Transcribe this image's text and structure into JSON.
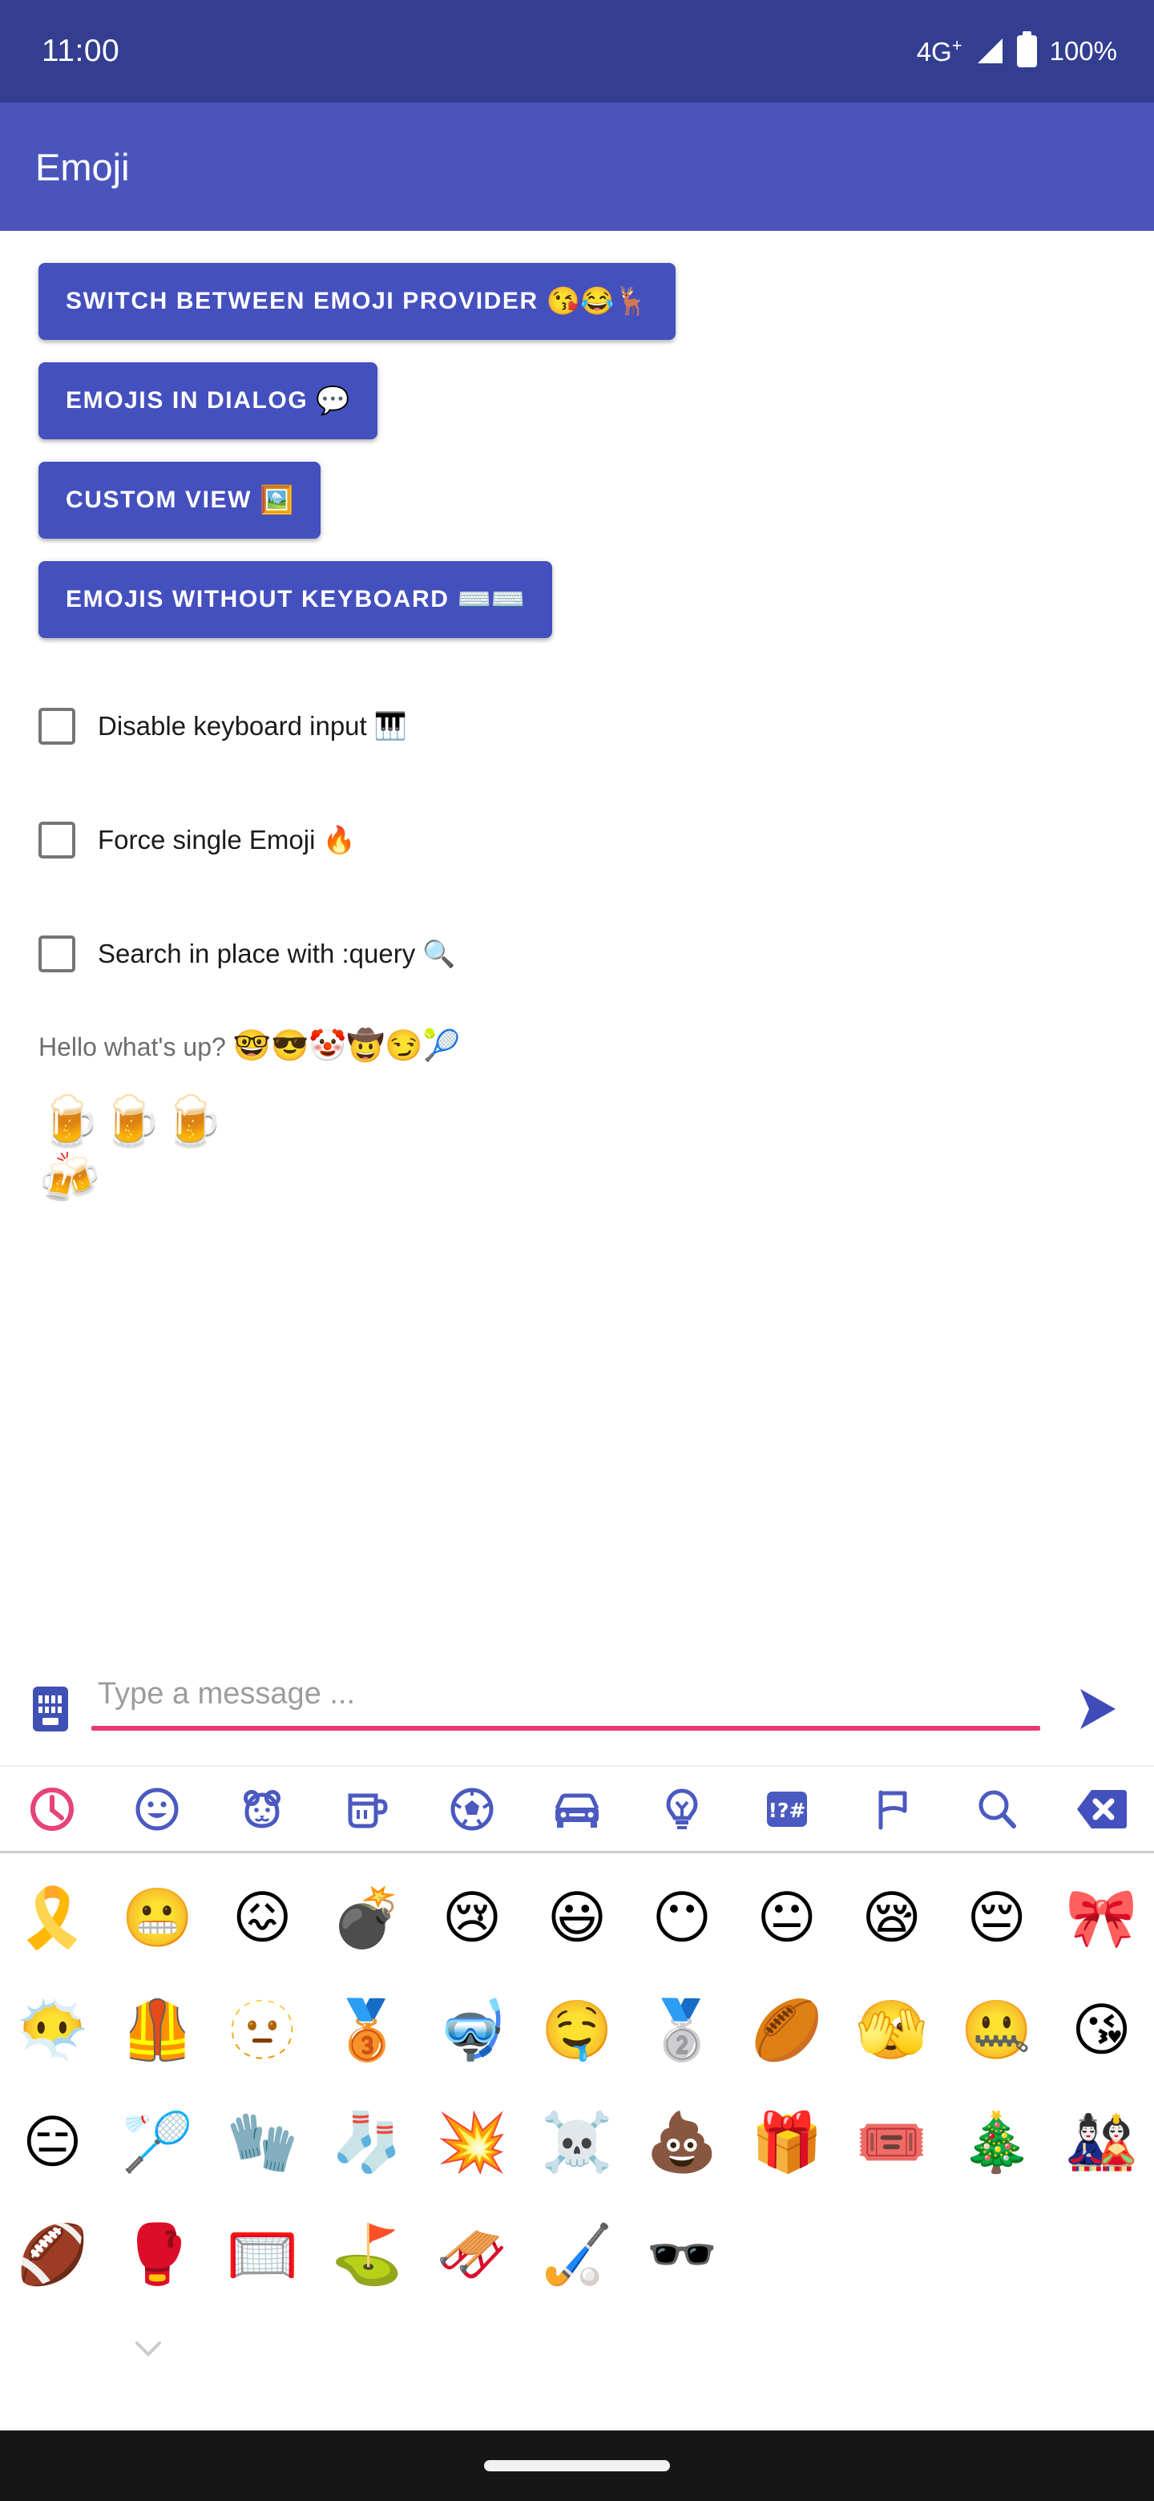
{
  "status_bar": {
    "time": "11:00",
    "network": "4G",
    "network_sup": "+",
    "battery": "100%",
    "signal_icon": "signal-bars-icon",
    "battery_icon": "battery-full-icon",
    "background": "#333E91"
  },
  "app_bar": {
    "title": "Emoji",
    "background": "#4A55BC"
  },
  "buttons": [
    {
      "label": "SWITCH BETWEEN EMOJI PROVIDER",
      "emoji": "😘😂🦌",
      "name": "switch-emoji-provider-button"
    },
    {
      "label": "EMOJIS IN DIALOG",
      "emoji": "💬",
      "name": "emojis-in-dialog-button"
    },
    {
      "label": "CUSTOM VIEW",
      "emoji": "🖼️",
      "name": "custom-view-button"
    },
    {
      "label": "EMOJIS WITHOUT KEYBOARD",
      "emoji": "⌨️⌨️",
      "name": "emojis-without-keyboard-button"
    }
  ],
  "checkboxes": [
    {
      "label": "Disable keyboard input 🎹",
      "checked": false,
      "name": "disable-keyboard-input-checkbox"
    },
    {
      "label": "Force single Emoji 🔥",
      "checked": false,
      "name": "force-single-emoji-checkbox"
    },
    {
      "label": "Search in place with :query 🔍",
      "checked": false,
      "name": "search-in-place-checkbox"
    }
  ],
  "sample": {
    "greeting_text": "Hello what's up? ",
    "greeting_emojis": "🤓😎🤡🤠😏🎾",
    "line_beers": "🍺🍺🍺",
    "line_cheers": "🍻"
  },
  "input_bar": {
    "keyboard_icon": "keyboard-icon",
    "placeholder": "Type a message ...",
    "value": "",
    "send_icon": "send-icon",
    "underline_color": "#E53B72",
    "icon_color": "#3F51B5"
  },
  "emoji_panel": {
    "active_category_index": 0,
    "active_color": "#E8427A",
    "inactive_color": "#4B5AC0",
    "categories": [
      {
        "name": "tab-recent",
        "icon": "clock-icon",
        "label": "Recent"
      },
      {
        "name": "tab-smileys",
        "icon": "smiley-icon",
        "label": "Smileys & People"
      },
      {
        "name": "tab-animals",
        "icon": "bear-icon",
        "label": "Animals & Nature"
      },
      {
        "name": "tab-food",
        "icon": "cup-icon",
        "label": "Food & Drink"
      },
      {
        "name": "tab-activity",
        "icon": "soccer-ball-icon",
        "label": "Activity"
      },
      {
        "name": "tab-travel",
        "icon": "car-icon",
        "label": "Travel & Places"
      },
      {
        "name": "tab-objects",
        "icon": "lightbulb-icon",
        "label": "Objects"
      },
      {
        "name": "tab-symbols",
        "icon": "symbols-icon",
        "label": "Symbols"
      },
      {
        "name": "tab-flags",
        "icon": "flag-icon",
        "label": "Flags"
      },
      {
        "name": "tab-search",
        "icon": "search-icon",
        "label": "Search"
      },
      {
        "name": "tab-backspace",
        "icon": "backspace-close-icon",
        "label": "Backspace"
      }
    ],
    "grid": [
      [
        {
          "emoji": "🎗️",
          "name": "reminder-ribbon"
        },
        {
          "emoji": "😬",
          "name": "grimacing-face"
        },
        {
          "emoji": "😖",
          "name": "confounded-face"
        },
        {
          "emoji": "💣",
          "name": "bomb"
        },
        {
          "emoji": "😢",
          "name": "crying-face"
        },
        {
          "emoji": "😃",
          "name": "grinning-face-big-eyes"
        },
        {
          "emoji": "😶",
          "name": "face-without-mouth"
        },
        {
          "emoji": "😐",
          "name": "neutral-face"
        },
        {
          "emoji": "😪",
          "name": "sleepy-face"
        },
        {
          "emoji": "😔",
          "name": "pensive-face"
        },
        {
          "emoji": "🎀",
          "name": "ribbon"
        }
      ],
      [
        {
          "emoji": "😶‍🌫️",
          "name": "face-in-clouds"
        },
        {
          "emoji": "🦺",
          "name": "safety-vest"
        },
        {
          "emoji": "🫥",
          "name": "dotted-line-face"
        },
        {
          "emoji": "🥉",
          "name": "third-place-medal"
        },
        {
          "emoji": "🤿",
          "name": "diving-mask"
        },
        {
          "emoji": "🤤",
          "name": "drooling-face"
        },
        {
          "emoji": "🥈",
          "name": "second-place-medal"
        },
        {
          "emoji": "🏉",
          "name": "rugby-football"
        },
        {
          "emoji": "🫣",
          "name": "face-with-peeking-eye"
        },
        {
          "emoji": "🤐",
          "name": "zipper-mouth-face"
        },
        {
          "emoji": "😘",
          "name": "face-blowing-a-kiss"
        }
      ],
      [
        {
          "emoji": "😑",
          "name": "expressionless-face"
        },
        {
          "emoji": "🏸",
          "name": "badminton"
        },
        {
          "emoji": "🧤",
          "name": "gloves"
        },
        {
          "emoji": "🧦",
          "name": "socks"
        },
        {
          "emoji": "💥",
          "name": "collision"
        },
        {
          "emoji": "☠️",
          "name": "skull-and-crossbones"
        },
        {
          "emoji": "💩",
          "name": "pile-of-poo"
        },
        {
          "emoji": "🎁",
          "name": "wrapped-gift"
        },
        {
          "emoji": "🎟️",
          "name": "admission-tickets"
        },
        {
          "emoji": "🎄",
          "name": "christmas-tree"
        },
        {
          "emoji": "🎎",
          "name": "japanese-dolls"
        }
      ],
      [
        {
          "emoji": "🏈",
          "name": "american-football"
        },
        {
          "emoji": "🥊",
          "name": "boxing-glove"
        },
        {
          "emoji": "🥅",
          "name": "goal-net"
        },
        {
          "emoji": "⛳",
          "name": "flag-in-hole"
        },
        {
          "emoji": "🛷",
          "name": "sled"
        },
        {
          "emoji": "🏑",
          "name": "field-hockey"
        },
        {
          "emoji": "🕶️",
          "name": "sunglasses"
        },
        {
          "emoji": "",
          "name": "empty-cell"
        },
        {
          "emoji": "",
          "name": "empty-cell"
        },
        {
          "emoji": "",
          "name": "empty-cell"
        },
        {
          "emoji": "",
          "name": "empty-cell"
        }
      ]
    ]
  },
  "nav_bar": {
    "gesture_pill": "home-gesture-pill"
  }
}
